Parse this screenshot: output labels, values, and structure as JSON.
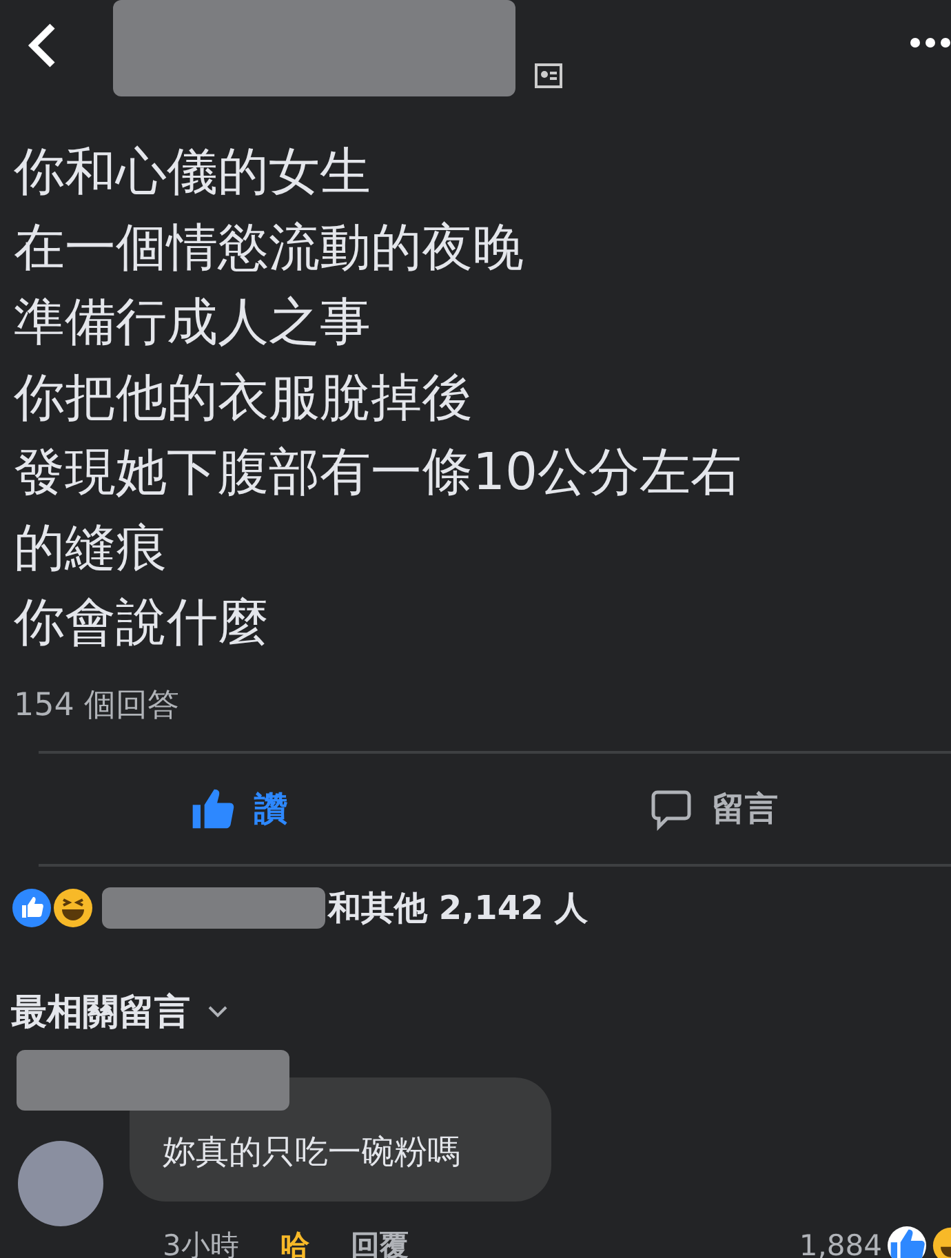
{
  "post": {
    "lines": [
      "你和心儀的女生",
      "在一個情慾流動的夜晚",
      "準備行成人之事",
      "你把他的衣服脫掉後",
      "發現她下腹部有一條10公分左右",
      "的縫痕",
      "你會說什麼"
    ],
    "answers": "154 個回答"
  },
  "actions": [
    {
      "kind": "like",
      "label": "讚",
      "selected": true
    },
    {
      "kind": "comment",
      "label": "留言",
      "selected": false
    }
  ],
  "reactions": {
    "text": "和其他 2,142 人"
  },
  "comments_sort": {
    "label": "最相關留言"
  },
  "comment": {
    "text": "妳真的只吃一碗粉嗎",
    "time": "3小時",
    "reaction": {
      "label": "哈",
      "selected": true
    },
    "reply": "回覆",
    "count": "1,884"
  }
}
